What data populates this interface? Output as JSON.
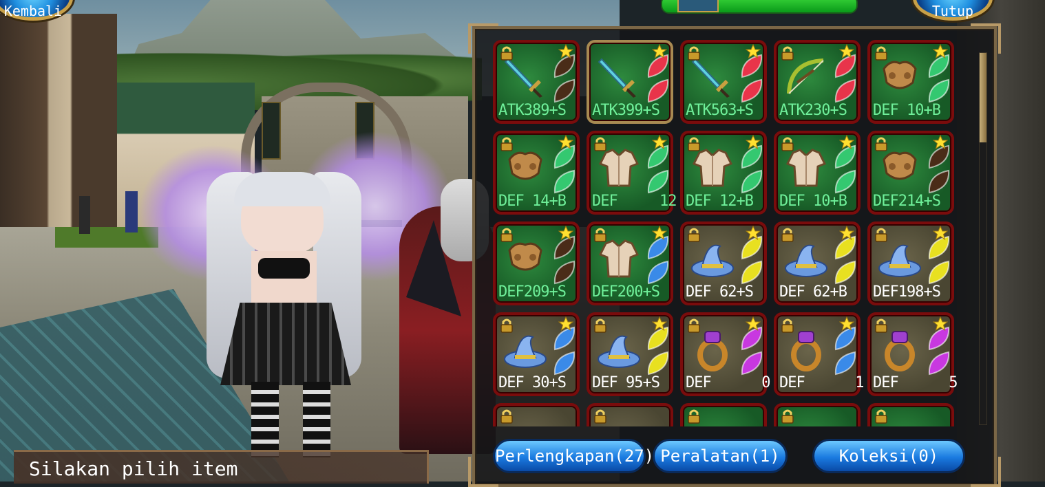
{
  "header": {
    "back_label": "Kembali",
    "close_label": "Tutup"
  },
  "grid": {
    "items": [
      {
        "stat": "ATK389+S",
        "bg": "green",
        "icon": "sword-icon",
        "sub": "leaf-icon",
        "sub_color": "#4a2c18",
        "locked": true,
        "starred": true,
        "selected": false
      },
      {
        "stat": "ATK399+S",
        "bg": "green",
        "icon": "sword-icon",
        "sub": "leaf-icon",
        "sub_color": "#e8344a",
        "locked": false,
        "starred": true,
        "selected": true
      },
      {
        "stat": "ATK563+S",
        "bg": "green",
        "icon": "sword-icon",
        "sub": "leaf-icon",
        "sub_color": "#e8344a",
        "locked": true,
        "starred": true,
        "selected": false
      },
      {
        "stat": "ATK230+S",
        "bg": "green",
        "icon": "bow-icon",
        "sub": "leaf-icon",
        "sub_color": "#e8344a",
        "locked": true,
        "starred": true,
        "selected": false
      },
      {
        "stat": "DEF 10+B",
        "bg": "green",
        "icon": "armor-icon",
        "sub": "leaf-icon",
        "sub_color": "#34c870",
        "locked": true,
        "starred": true,
        "selected": false
      },
      {
        "stat": "DEF 14+B",
        "bg": "green",
        "icon": "armor-icon",
        "sub": "leaf-icon",
        "sub_color": "#34c870",
        "locked": true,
        "starred": true,
        "selected": false
      },
      {
        "stat": "DEF     12",
        "bg": "green",
        "icon": "shirt-icon",
        "sub": "leaf-icon",
        "sub_color": "#34c870",
        "locked": true,
        "starred": true,
        "selected": false
      },
      {
        "stat": "DEF 12+B",
        "bg": "green",
        "icon": "shirt-icon",
        "sub": "leaf-icon",
        "sub_color": "#34c870",
        "locked": true,
        "starred": true,
        "selected": false
      },
      {
        "stat": "DEF 10+B",
        "bg": "green",
        "icon": "shirt-icon",
        "sub": "leaf-icon",
        "sub_color": "#34c870",
        "locked": true,
        "starred": true,
        "selected": false
      },
      {
        "stat": "DEF214+S",
        "bg": "green",
        "icon": "armor-icon",
        "sub": "leaf-icon",
        "sub_color": "#4a2c18",
        "locked": true,
        "starred": true,
        "selected": false
      },
      {
        "stat": "DEF209+S",
        "bg": "green",
        "icon": "armor-icon",
        "sub": "leaf-icon",
        "sub_color": "#4a2c18",
        "locked": true,
        "starred": true,
        "selected": false
      },
      {
        "stat": "DEF200+S",
        "bg": "green",
        "icon": "shirt-icon",
        "sub": "leaf-icon",
        "sub_color": "#3a8ae8",
        "locked": true,
        "starred": true,
        "selected": false
      },
      {
        "stat": "DEF 62+S",
        "bg": "brown",
        "icon": "hat-icon",
        "sub": "leaf-icon",
        "sub_color": "#e8e020",
        "locked": true,
        "starred": true,
        "selected": false
      },
      {
        "stat": "DEF 62+B",
        "bg": "brown",
        "icon": "hat-icon",
        "sub": "leaf-icon",
        "sub_color": "#e8e020",
        "locked": true,
        "starred": true,
        "selected": false
      },
      {
        "stat": "DEF198+S",
        "bg": "brown",
        "icon": "hat-icon",
        "sub": "leaf-icon",
        "sub_color": "#e8e020",
        "locked": true,
        "starred": true,
        "selected": false
      },
      {
        "stat": "DEF 30+S",
        "bg": "brown",
        "icon": "hat-icon",
        "sub": "leaf-icon",
        "sub_color": "#3a8ae8",
        "locked": true,
        "starred": true,
        "selected": false
      },
      {
        "stat": "DEF 95+S",
        "bg": "brown",
        "icon": "hat-icon",
        "sub": "leaf-icon",
        "sub_color": "#e8e020",
        "locked": true,
        "starred": true,
        "selected": false
      },
      {
        "stat": "DEF      0",
        "bg": "brown",
        "icon": "ring-icon",
        "sub": "leaf-icon",
        "sub_color": "#c838e0",
        "locked": true,
        "starred": true,
        "selected": false
      },
      {
        "stat": "DEF      1",
        "bg": "brown",
        "icon": "ring-icon",
        "sub": "leaf-icon",
        "sub_color": "#3a8ae8",
        "locked": true,
        "starred": true,
        "selected": false
      },
      {
        "stat": "DEF      5",
        "bg": "brown",
        "icon": "ring-icon",
        "sub": "leaf-icon",
        "sub_color": "#c838e0",
        "locked": true,
        "starred": true,
        "selected": false
      },
      {
        "stat": "",
        "bg": "brown",
        "icon": "",
        "sub": "",
        "sub_color": "#e8344a",
        "locked": true,
        "starred": false,
        "selected": false
      },
      {
        "stat": "",
        "bg": "brown",
        "icon": "",
        "sub": "",
        "sub_color": "#e8344a",
        "locked": true,
        "starred": false,
        "selected": false
      },
      {
        "stat": "",
        "bg": "green",
        "icon": "",
        "sub": "",
        "sub_color": "#34c870",
        "locked": true,
        "starred": false,
        "selected": false
      },
      {
        "stat": "",
        "bg": "green",
        "icon": "",
        "sub": "",
        "sub_color": "#34c870",
        "locked": true,
        "starred": false,
        "selected": false
      },
      {
        "stat": "",
        "bg": "green",
        "icon": "",
        "sub": "",
        "sub_color": "#34c870",
        "locked": true,
        "starred": false,
        "selected": false
      }
    ]
  },
  "tabs": [
    {
      "label": "Perlengkapan(27)"
    },
    {
      "label": "Peralatan(1)"
    },
    {
      "label": "Koleksi(0)"
    }
  ],
  "message": "Silakan pilih item",
  "colors": {
    "text_green": "#6ff09a",
    "text_white": "#ffffff",
    "bg_green": "#175a26",
    "bg_brown": "#4a4632",
    "slot_border": "#7a0c0c"
  }
}
